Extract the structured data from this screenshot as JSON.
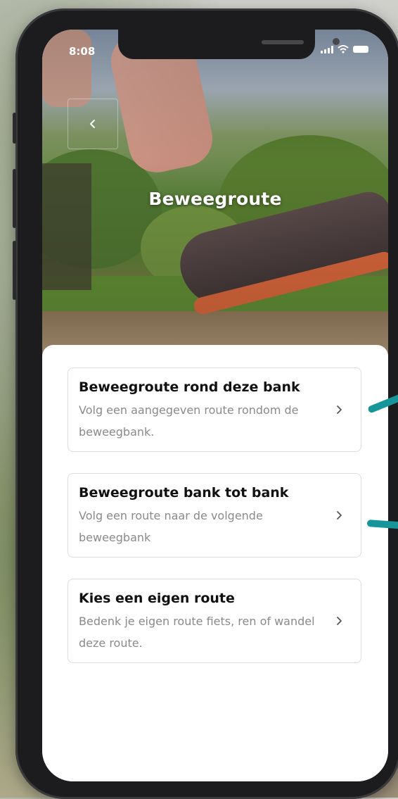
{
  "status_bar": {
    "time": "8:08"
  },
  "header": {
    "title": "Beweegroute"
  },
  "routes": [
    {
      "title": "Beweegroute rond deze bank",
      "description": "Volg een aangegeven route rondom de beweegbank."
    },
    {
      "title": "Beweegroute bank tot bank",
      "description": "Volg een route naar de volgende beweegbank"
    },
    {
      "title": "Kies een eigen route",
      "description": "Bedenk je eigen route fiets, ren of wandel deze route."
    }
  ],
  "colors": {
    "accent_pointer": "#16959a",
    "card_border": "#dcdcdc",
    "text_muted": "#8a8a8a"
  },
  "icons": {
    "back": "chevron-left-icon",
    "row": "chevron-right-icon"
  }
}
